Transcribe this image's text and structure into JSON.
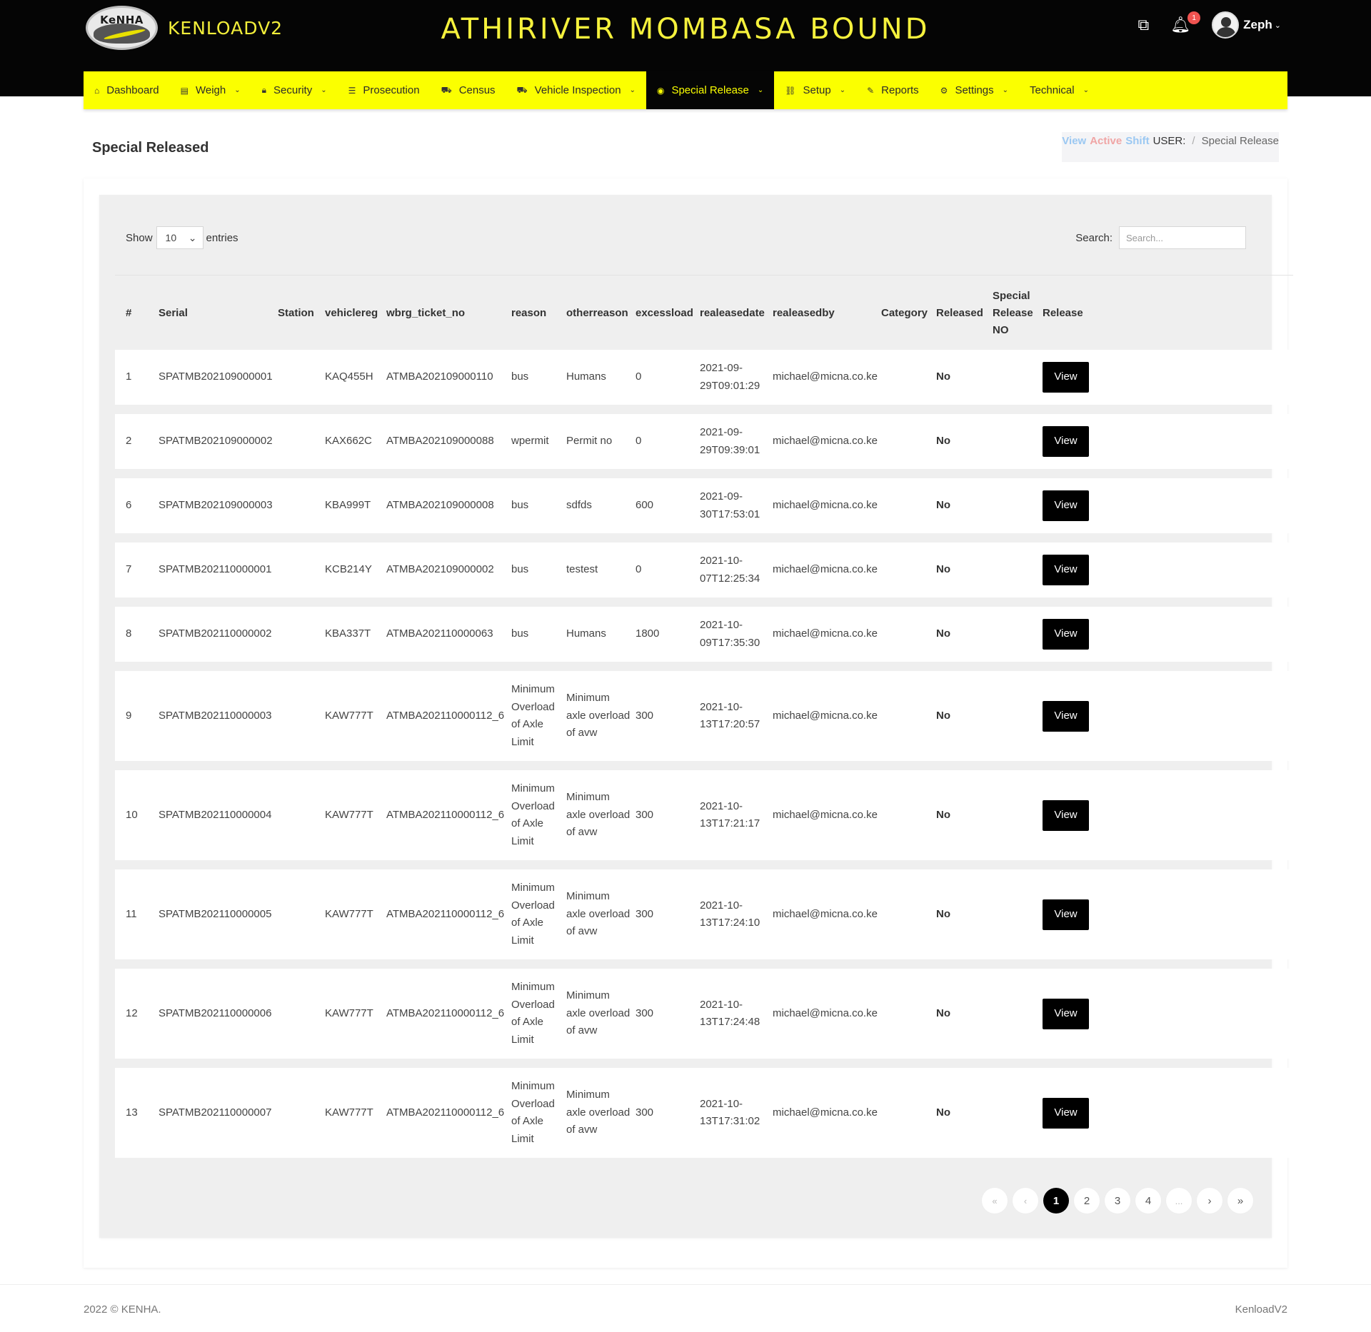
{
  "header": {
    "logo_text": "KeNHA",
    "brand": "KENLOADV2",
    "station_title": "ATHIRIVER MOMBASA BOUND",
    "notification_count": "1",
    "user_name": "Zeph",
    "icons": [
      "apps-icon",
      "bell-icon",
      "user-avatar"
    ]
  },
  "nav": {
    "items": [
      {
        "label": "Dashboard",
        "icon": "home-icon",
        "dropdown": false
      },
      {
        "label": "Weigh",
        "icon": "scale-icon",
        "dropdown": true
      },
      {
        "label": "Security",
        "icon": "lock-icon",
        "dropdown": true
      },
      {
        "label": "Prosecution",
        "icon": "list-icon",
        "dropdown": false
      },
      {
        "label": "Census",
        "icon": "car-icon",
        "dropdown": false
      },
      {
        "label": "Vehicle Inspection",
        "icon": "truck-icon",
        "dropdown": true
      },
      {
        "label": "Special Release",
        "icon": "target-icon",
        "dropdown": true,
        "active": true
      },
      {
        "label": "Setup",
        "icon": "link-icon",
        "dropdown": true
      },
      {
        "label": "Reports",
        "icon": "paperclip-icon",
        "dropdown": false
      },
      {
        "label": "Settings",
        "icon": "gear-icon",
        "dropdown": true
      },
      {
        "label": "Technical",
        "icon": "",
        "dropdown": true
      }
    ],
    "colors": {
      "bar": "#fbff00",
      "active_bg": "#050505"
    }
  },
  "page": {
    "title": "Special Released",
    "breadcrumb": {
      "view": "View",
      "active": "Active",
      "shift": "Shift",
      "user": "USER:",
      "current": "Special Release"
    }
  },
  "table_controls": {
    "show_label": "Show",
    "entries_value": "10",
    "entries_label": "entries",
    "search_label": "Search:",
    "search_placeholder": "Search..."
  },
  "table": {
    "headers": [
      "#",
      "Serial",
      "Station",
      "vehiclereg",
      "wbrg_ticket_no",
      "reason",
      "otherreason",
      "excessload",
      "realeasedate",
      "realeasedby",
      "Category",
      "Released",
      "Special Release NO",
      "Release"
    ],
    "rows": [
      {
        "num": "1",
        "serial": "SPATMB202109000001",
        "station": "",
        "vehiclereg": "KAQ455H",
        "ticket": "ATMBA202109000110",
        "reason": "bus",
        "otherreason": "Humans",
        "excessload": "0",
        "date": "2021-09-29T09:01:29",
        "by": "michael@micna.co.ke",
        "category": "",
        "released": "No",
        "srno": "",
        "action": "View"
      },
      {
        "num": "2",
        "serial": "SPATMB202109000002",
        "station": "",
        "vehiclereg": "KAX662C",
        "ticket": "ATMBA202109000088",
        "reason": "wpermit",
        "otherreason": "Permit no",
        "excessload": "0",
        "date": "2021-09-29T09:39:01",
        "by": "michael@micna.co.ke",
        "category": "",
        "released": "No",
        "srno": "",
        "action": "View"
      },
      {
        "num": "6",
        "serial": "SPATMB202109000003",
        "station": "",
        "vehiclereg": "KBA999T",
        "ticket": "ATMBA202109000008",
        "reason": "bus",
        "otherreason": "sdfds",
        "excessload": "600",
        "date": "2021-09-30T17:53:01",
        "by": "michael@micna.co.ke",
        "category": "",
        "released": "No",
        "srno": "",
        "action": "View"
      },
      {
        "num": "7",
        "serial": "SPATMB202110000001",
        "station": "",
        "vehiclereg": "KCB214Y",
        "ticket": "ATMBA202109000002",
        "reason": "bus",
        "otherreason": "testest",
        "excessload": "0",
        "date": "2021-10-07T12:25:34",
        "by": "michael@micna.co.ke",
        "category": "",
        "released": "No",
        "srno": "",
        "action": "View"
      },
      {
        "num": "8",
        "serial": "SPATMB202110000002",
        "station": "",
        "vehiclereg": "KBA337T",
        "ticket": "ATMBA202110000063",
        "reason": "bus",
        "otherreason": "Humans",
        "excessload": "1800",
        "date": "2021-10-09T17:35:30",
        "by": "michael@micna.co.ke",
        "category": "",
        "released": "No",
        "srno": "",
        "action": "View"
      },
      {
        "num": "9",
        "serial": "SPATMB202110000003",
        "station": "",
        "vehiclereg": "KAW777T",
        "ticket": "ATMBA202110000112_6",
        "reason": "Minimum Overload of Axle Limit",
        "otherreason": "Minimum axle overload of avw",
        "excessload": "300",
        "date": "2021-10-13T17:20:57",
        "by": "michael@micna.co.ke",
        "category": "",
        "released": "No",
        "srno": "",
        "action": "View"
      },
      {
        "num": "10",
        "serial": "SPATMB202110000004",
        "station": "",
        "vehiclereg": "KAW777T",
        "ticket": "ATMBA202110000112_6",
        "reason": "Minimum Overload of Axle Limit",
        "otherreason": "Minimum axle overload of avw",
        "excessload": "300",
        "date": "2021-10-13T17:21:17",
        "by": "michael@micna.co.ke",
        "category": "",
        "released": "No",
        "srno": "",
        "action": "View"
      },
      {
        "num": "11",
        "serial": "SPATMB202110000005",
        "station": "",
        "vehiclereg": "KAW777T",
        "ticket": "ATMBA202110000112_6",
        "reason": "Minimum Overload of Axle Limit",
        "otherreason": "Minimum axle overload of avw",
        "excessload": "300",
        "date": "2021-10-13T17:24:10",
        "by": "michael@micna.co.ke",
        "category": "",
        "released": "No",
        "srno": "",
        "action": "View"
      },
      {
        "num": "12",
        "serial": "SPATMB202110000006",
        "station": "",
        "vehiclereg": "KAW777T",
        "ticket": "ATMBA202110000112_6",
        "reason": "Minimum Overload of Axle Limit",
        "otherreason": "Minimum axle overload of avw",
        "excessload": "300",
        "date": "2021-10-13T17:24:48",
        "by": "michael@micna.co.ke",
        "category": "",
        "released": "No",
        "srno": "",
        "action": "View"
      },
      {
        "num": "13",
        "serial": "SPATMB202110000007",
        "station": "",
        "vehiclereg": "KAW777T",
        "ticket": "ATMBA202110000112_6",
        "reason": "Minimum Overload of Axle Limit",
        "otherreason": "Minimum axle overload of avw",
        "excessload": "300",
        "date": "2021-10-13T17:31:02",
        "by": "michael@micna.co.ke",
        "category": "",
        "released": "No",
        "srno": "",
        "action": "View"
      }
    ]
  },
  "pagination": {
    "first": "«",
    "prev": "‹",
    "pages": [
      "1",
      "2",
      "3",
      "4"
    ],
    "ellipsis": "...",
    "next": "›",
    "last": "»",
    "current": "1"
  },
  "footer": {
    "copyright": "2022 © KENHA.",
    "app_name": "KenloadV2"
  }
}
